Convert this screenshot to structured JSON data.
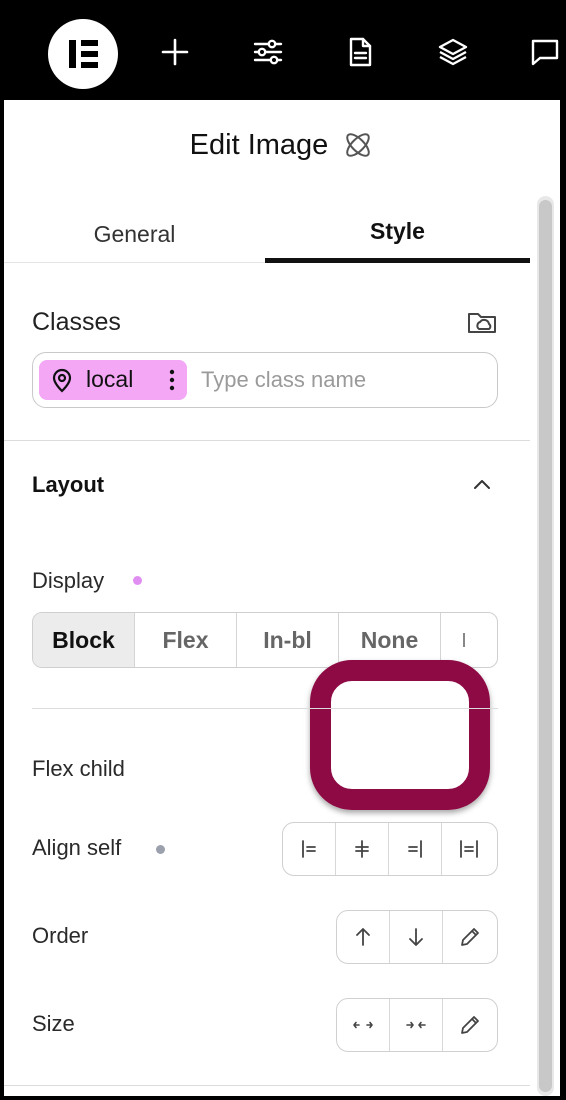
{
  "topbar": {
    "icons": [
      "elementor-logo-icon",
      "plus-icon",
      "sliders-icon",
      "page-icon",
      "layers-icon",
      "chat-icon"
    ]
  },
  "header": {
    "title": "Edit Image",
    "title_icon": "atom-icon"
  },
  "tabs": [
    {
      "label": "General",
      "active": false
    },
    {
      "label": "Style",
      "active": true
    }
  ],
  "classes": {
    "label": "Classes",
    "chip_label": "local",
    "chip_color": "#f3a7f5",
    "input_placeholder": "Type class name"
  },
  "layout": {
    "title": "Layout",
    "display_label": "Display",
    "display_dot_color": "#e08ef2",
    "display_options": [
      "Block",
      "Flex",
      "In-bl",
      "None"
    ],
    "display_selected": "Block",
    "flex_child_label": "Flex child",
    "align_self_label": "Align self",
    "align_self_dot_color": "#9aa0ac",
    "order_label": "Order",
    "size_label": "Size"
  },
  "highlight_color": "#8e0a44"
}
